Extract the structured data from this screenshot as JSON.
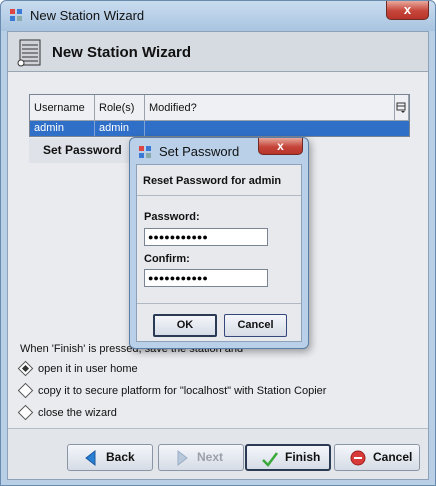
{
  "window": {
    "title": "New Station Wizard",
    "close_label": "x"
  },
  "header": {
    "title": "New Station Wizard",
    "icon": "server-rack-icon"
  },
  "table": {
    "columns": [
      "Username",
      "Role(s)",
      "Modified?"
    ],
    "rows": [
      {
        "username": "admin",
        "roles": "admin",
        "modified": ""
      }
    ],
    "selected_row": 0
  },
  "set_password_button": "Set Password",
  "finish_options": {
    "intro": "When 'Finish' is pressed, save the station and",
    "options": [
      {
        "label": "open it in user home",
        "checked": true
      },
      {
        "label": "copy it to secure platform for \"localhost\" with Station Copier",
        "checked": false
      },
      {
        "label": "close the wizard",
        "checked": false
      }
    ]
  },
  "footer": {
    "back": "Back",
    "next": "Next",
    "finish": "Finish",
    "cancel": "Cancel"
  },
  "dialog": {
    "title": "Set Password",
    "close_label": "x",
    "heading": "Reset Password for admin",
    "password_label": "Password:",
    "password_value": "●●●●●●●●●●●",
    "confirm_label": "Confirm:",
    "confirm_value": "●●●●●●●●●●●",
    "ok": "OK",
    "cancel": "Cancel"
  },
  "colors": {
    "title_bar": "#b9d0e8",
    "selection": "#2f6fc8",
    "close_button": "#c6453a",
    "back_arrow": "#2a7fd4",
    "finish_check": "#3aa83a",
    "cancel_icon": "#d83a3a"
  }
}
